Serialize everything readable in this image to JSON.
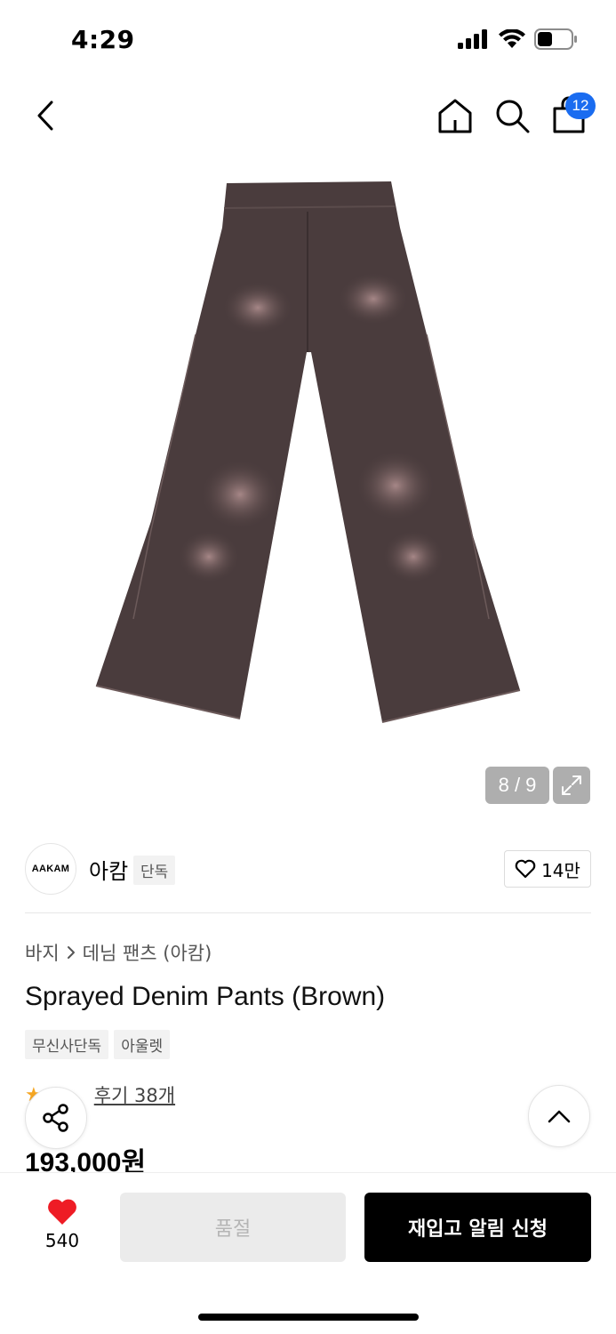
{
  "status_bar": {
    "time": "4:29"
  },
  "nav": {
    "cart_count": "12"
  },
  "gallery": {
    "counter": "8 / 9"
  },
  "brand": {
    "logo_text": "AAKAM",
    "name": "아캄",
    "exclusive_tag": "단독",
    "like_count": "14만"
  },
  "breadcrumb": {
    "category": "바지",
    "subcategory": "데님 팬츠 (아캄)"
  },
  "product": {
    "title": "Sprayed Denim Pants (Brown)",
    "tags": [
      "무신사단독",
      "아울렛"
    ],
    "review_link": "후기 38개",
    "price": "193,000원"
  },
  "bottom_bar": {
    "like_count": "540",
    "soldout_label": "품절",
    "restock_label": "재입고 알림 신청"
  },
  "colors": {
    "accent": "#1a6cf0",
    "heart": "#ee1c25",
    "star": "#f5a623"
  }
}
